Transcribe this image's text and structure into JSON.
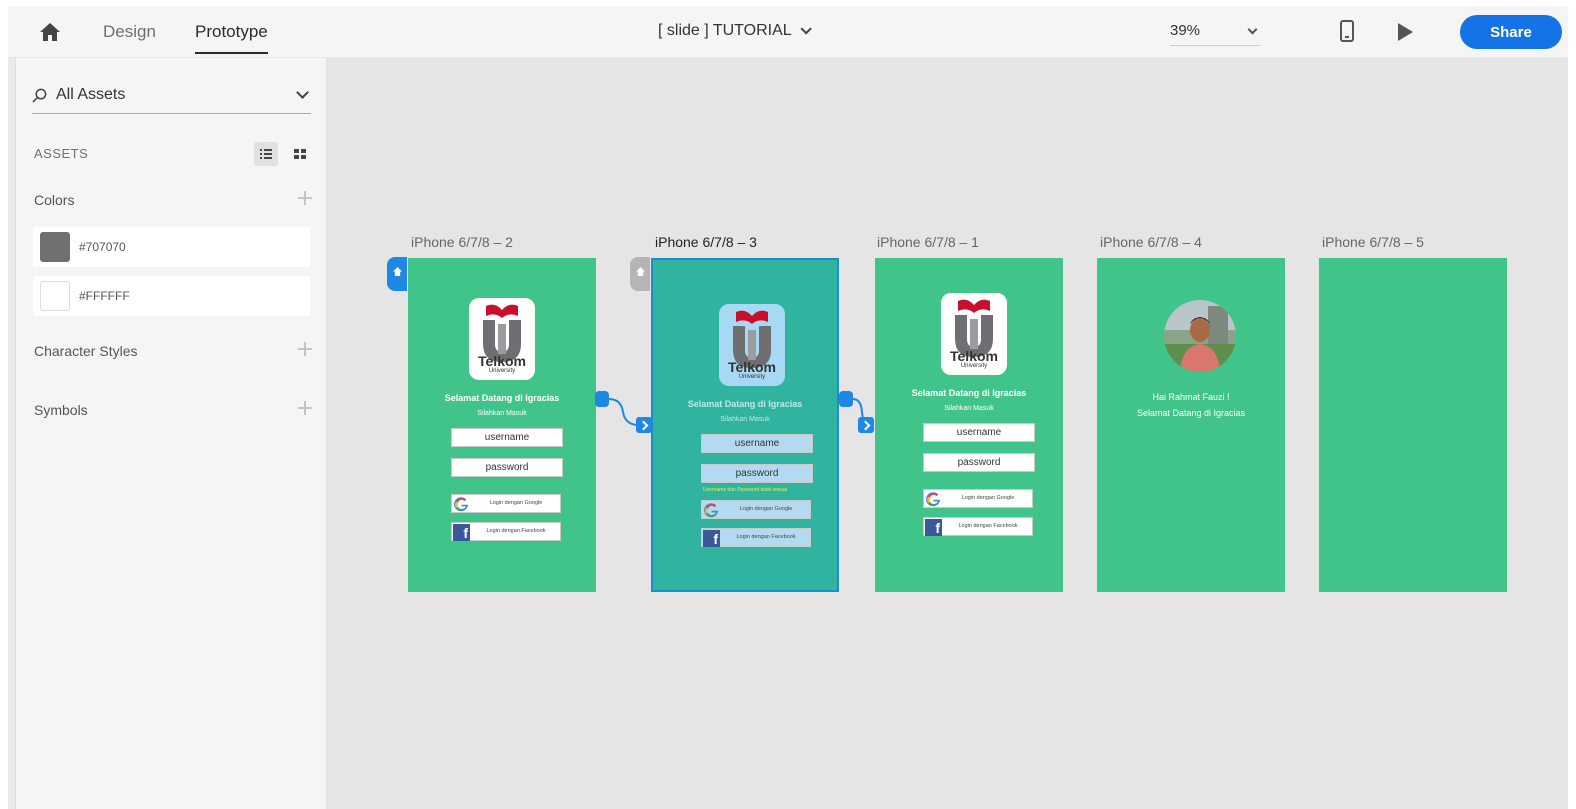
{
  "topbar": {
    "tabs": [
      {
        "label": "Design"
      },
      {
        "label": "Prototype"
      }
    ],
    "document_title": "[ slide ] TUTORIAL",
    "zoom": "39%",
    "share_label": "Share"
  },
  "panel": {
    "search_label": "All Assets",
    "assets_heading": "ASSETS",
    "sections": {
      "colors": "Colors",
      "character_styles": "Character Styles",
      "symbols": "Symbols"
    },
    "colors": [
      {
        "label": "#707070",
        "hex": "#707070"
      },
      {
        "label": "#FFFFFF",
        "hex": "#FFFFFF"
      }
    ]
  },
  "artboards": [
    {
      "title": "iPhone 6/7/8 – 2",
      "welcome": "Selamat Datang di Igracias",
      "sub": "Silahkan Masuk",
      "username": "username",
      "password": "password",
      "google": "Login dengan Google",
      "facebook": "Login dengan Facebook",
      "logo_text": "Telkom",
      "logo_sub": "University"
    },
    {
      "title": "iPhone 6/7/8 – 3",
      "welcome": "Selamat Datang di Igracias",
      "sub": "Silahkan Masuk",
      "username": "username",
      "password": "password",
      "error": "Username dan Password tidak sesuai",
      "google": "Login dengan Google",
      "facebook": "Login dengan Facebook",
      "logo_text": "Telkom",
      "logo_sub": "University"
    },
    {
      "title": "iPhone 6/7/8 – 1",
      "welcome": "Selamat Datang di Igracias",
      "sub": "Silahkan Masuk",
      "username": "username",
      "password": "password",
      "google": "Login dengan Google",
      "facebook": "Login dengan Facebook",
      "logo_text": "Telkom",
      "logo_sub": "University"
    },
    {
      "title": "iPhone 6/7/8 – 4",
      "greeting_1": "Hai Rahmat Fauzi !",
      "greeting_2": "Selamat Datang di Igracias"
    },
    {
      "title": "iPhone 6/7/8 – 5"
    }
  ],
  "colors": {
    "accent": "#1473e6",
    "artboard_green": "#41c48a",
    "artboard_teal": "#31b49f",
    "connector": "#1e88e5"
  }
}
